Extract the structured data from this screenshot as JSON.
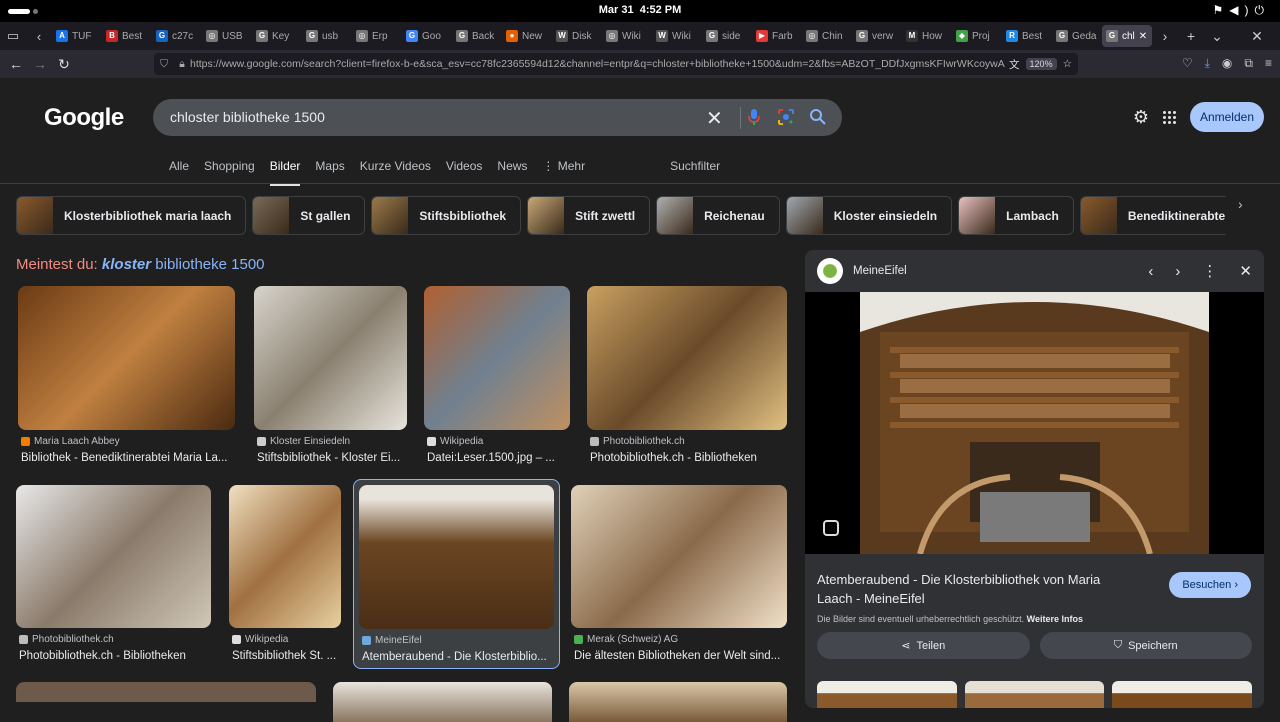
{
  "os": {
    "date": "Mar 31",
    "time": "4:52 PM",
    "tray": [
      "network-icon",
      "volume-icon",
      "power-icon"
    ]
  },
  "tabs": [
    {
      "label": "TUF",
      "color": "#1a73e8",
      "icon": "A"
    },
    {
      "label": "Best",
      "color": "#c62828",
      "icon": "B"
    },
    {
      "label": "c27c",
      "color": "#1565c0",
      "icon": "G"
    },
    {
      "label": "USB",
      "color": "#777",
      "icon": "◎"
    },
    {
      "label": "Key",
      "color": "#777",
      "icon": "G"
    },
    {
      "label": "usb",
      "color": "#777",
      "icon": "G"
    },
    {
      "label": "Erp",
      "color": "#777",
      "icon": "◎"
    },
    {
      "label": "Goo",
      "color": "#4285f4",
      "icon": "G"
    },
    {
      "label": "Back",
      "color": "#777",
      "icon": "G"
    },
    {
      "label": "New",
      "color": "#e66000",
      "icon": "●"
    },
    {
      "label": "Disk",
      "color": "#555",
      "icon": "W"
    },
    {
      "label": "Wiki",
      "color": "#777",
      "icon": "◎"
    },
    {
      "label": "Wiki",
      "color": "#555",
      "icon": "W"
    },
    {
      "label": "side",
      "color": "#777",
      "icon": "G"
    },
    {
      "label": "Farb",
      "color": "#e53935",
      "icon": "▶"
    },
    {
      "label": "Chin",
      "color": "#777",
      "icon": "◎"
    },
    {
      "label": "verw",
      "color": "#777",
      "icon": "G"
    },
    {
      "label": "How",
      "color": "#333",
      "icon": "M"
    },
    {
      "label": "Proj",
      "color": "#43a047",
      "icon": "◆"
    },
    {
      "label": "Best",
      "color": "#1e88e5",
      "icon": "R"
    },
    {
      "label": "Geda",
      "color": "#777",
      "icon": "G"
    },
    {
      "label": "chl",
      "color": "#777",
      "icon": "G",
      "active": true
    }
  ],
  "url": "https://www.google.com/search?client=firefox-b-e&sca_esv=cc78fc2365594d12&channel=entpr&q=chloster+bibliotheke+1500&udm=2&fbs=ABzOT_DDfJxgmsKFIwrWKcoywA",
  "zoom": "120%",
  "logo": "Google",
  "query": "chloster bibliotheke 1500",
  "signin": "Anmelden",
  "navtabs": [
    "Alle",
    "Shopping",
    "Bilder",
    "Maps",
    "Kurze Videos",
    "Videos",
    "News",
    "⋮ Mehr"
  ],
  "active_tab": "Bilder",
  "filter": "Suchfilter",
  "chips": [
    "Klosterbibliothek maria laach",
    "St gallen",
    "Stiftsbibliothek",
    "Stift zwettl",
    "Reichenau",
    "Kloster einsiedeln",
    "Lambach",
    "Benediktinerabtei maria"
  ],
  "didyou": {
    "prefix": "Meintest du:",
    "em": "kloster",
    "rest": "bibliotheke 1500"
  },
  "results": [
    {
      "source": "Maria Laach Abbey",
      "title": "Bibliothek - Benediktinerabtei Maria La...",
      "scolor": "#f57c00"
    },
    {
      "source": "Kloster Einsiedeln",
      "title": "Stiftsbibliothek - Kloster Ei...",
      "scolor": "#ccc"
    },
    {
      "source": "Wikipedia",
      "title": "Datei:Leser.1500.jpg – ...",
      "scolor": "#ddd"
    },
    {
      "source": "Photobibliothek.ch",
      "title": "Photobibliothek.ch - Bibliotheken",
      "scolor": "#bbb"
    },
    {
      "source": "Photobibliothek.ch",
      "title": "Photobibliothek.ch - Bibliotheken",
      "scolor": "#bbb"
    },
    {
      "source": "Wikipedia",
      "title": "Stiftsbibliothek St. ...",
      "scolor": "#ddd"
    },
    {
      "source": "MeineEifel",
      "title": "Atemberaubend - Die Klosterbiblio...",
      "scolor": "#6fa8dc"
    },
    {
      "source": "Merak (Schweiz) AG",
      "title": "Die ältesten Bibliotheken der Welt sind...",
      "scolor": "#4caf50"
    }
  ],
  "panel": {
    "site": "MeineEifel",
    "title": "Atemberaubend - Die Klosterbibliothek von Maria Laach - MeineEifel",
    "visit": "Besuchen",
    "copyright": "Die Bilder sind eventuell urheberrechtlich geschützt.",
    "more_info": "Weitere Infos",
    "share": "Teilen",
    "save": "Speichern"
  },
  "colors": {
    "accent": "#a8c7fa",
    "link": "#8ab4f8",
    "didyou": "#f28b82"
  }
}
